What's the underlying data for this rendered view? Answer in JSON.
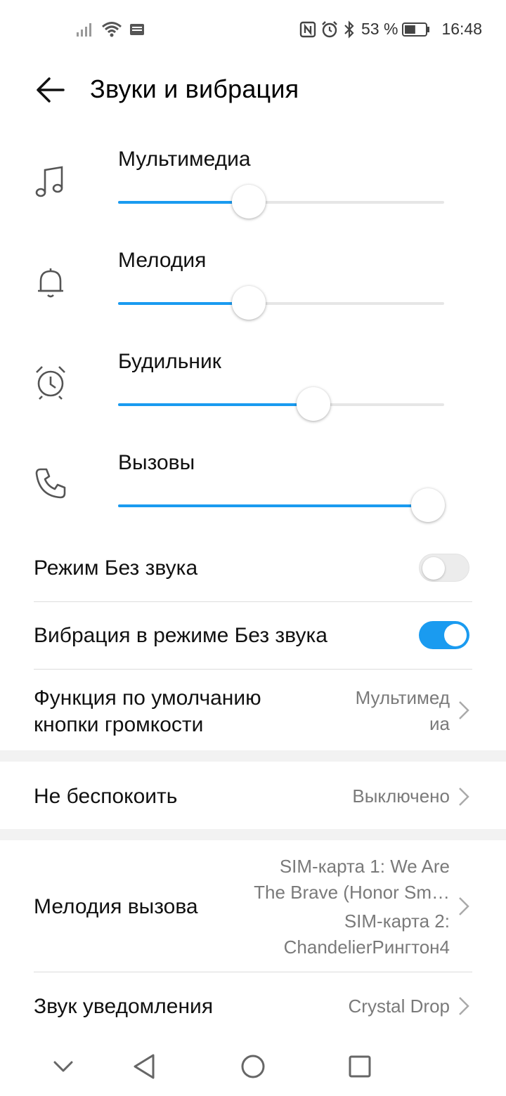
{
  "status": {
    "battery_percent": "53 %",
    "battery_level": 0.53,
    "time": "16:48"
  },
  "header": {
    "title": "Звуки и вибрация"
  },
  "volumes": [
    {
      "label": "Мультимедиа",
      "icon": "music-note-icon",
      "level": 0.4
    },
    {
      "label": "Мелодия",
      "icon": "bell-icon",
      "level": 0.4
    },
    {
      "label": "Будильник",
      "icon": "alarm-clock-icon",
      "level": 0.6
    },
    {
      "label": "Вызовы",
      "icon": "phone-icon",
      "level": 0.95
    }
  ],
  "settings": {
    "silent_mode": {
      "label": "Режим Без звука",
      "enabled": false
    },
    "vibrate_silent": {
      "label": "Вибрация в режиме Без звука",
      "enabled": true
    },
    "volume_key_default": {
      "label_line1": "Функция по умолчанию",
      "label_line2": "кнопки громкости",
      "value_line1": "Мультимед",
      "value_line2": "иа"
    },
    "dnd": {
      "label": "Не беспокоить",
      "value": "Выключено"
    },
    "ringtone": {
      "label": "Мелодия вызова",
      "value_line1": "SIM-карта 1: We Are",
      "value_line2": "The Brave (Honor Sm…",
      "value_line3": "SIM-карта 2:",
      "value_line4": "ChandelierРингтон4"
    },
    "notification_sound": {
      "label": "Звук уведомления",
      "value": "Crystal Drop"
    }
  },
  "colors": {
    "accent": "#1a9bf0",
    "track": "#e6e6e6",
    "divider": "#dcdcdc",
    "secondary_text": "#7a7a7a"
  }
}
